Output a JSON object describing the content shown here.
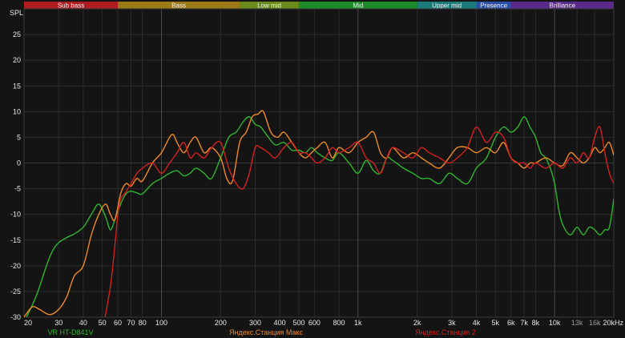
{
  "chart_data": {
    "type": "line",
    "ylabel": "SPL",
    "xscale": "log",
    "xlim": [
      20,
      20000
    ],
    "ylim": [
      -30,
      30
    ],
    "grid": true,
    "yticks": [
      25,
      20,
      15,
      10,
      5,
      0,
      -5,
      -10,
      -15,
      -20,
      -25,
      -30
    ],
    "xticks": [
      {
        "v": 20,
        "label": "20"
      },
      {
        "v": 30,
        "label": "30"
      },
      {
        "v": 40,
        "label": "40"
      },
      {
        "v": 50,
        "label": "50"
      },
      {
        "v": 60,
        "label": "60"
      },
      {
        "v": 70,
        "label": "70"
      },
      {
        "v": 80,
        "label": "80"
      },
      {
        "v": 100,
        "label": "100"
      },
      {
        "v": 200,
        "label": "200"
      },
      {
        "v": 300,
        "label": "300"
      },
      {
        "v": 400,
        "label": "400"
      },
      {
        "v": 500,
        "label": "500"
      },
      {
        "v": 600,
        "label": "600"
      },
      {
        "v": 800,
        "label": "800"
      },
      {
        "v": 1000,
        "label": "1k"
      },
      {
        "v": 2000,
        "label": "2k"
      },
      {
        "v": 3000,
        "label": "3k"
      },
      {
        "v": 4000,
        "label": "4k"
      },
      {
        "v": 5000,
        "label": "5k"
      },
      {
        "v": 6000,
        "label": "6k"
      },
      {
        "v": 7000,
        "label": "7k"
      },
      {
        "v": 8000,
        "label": "8k"
      },
      {
        "v": 10000,
        "label": "10k"
      },
      {
        "v": 13000,
        "label": "13k"
      },
      {
        "v": 16000,
        "label": "16k"
      },
      {
        "v": 20000,
        "label": "20kHz"
      }
    ],
    "bands": [
      {
        "name": "Sub bass",
        "from": 20,
        "to": 60,
        "color": "#b01c22"
      },
      {
        "name": "Bass",
        "from": 60,
        "to": 250,
        "color": "#9c7a17"
      },
      {
        "name": "Low mid",
        "from": 250,
        "to": 500,
        "color": "#6a8a1a"
      },
      {
        "name": "Mid",
        "from": 500,
        "to": 2000,
        "color": "#1f8a2a"
      },
      {
        "name": "Upper mid",
        "from": 2000,
        "to": 4000,
        "color": "#1b7a7a"
      },
      {
        "name": "Presence",
        "from": 4000,
        "to": 6000,
        "color": "#2a4ea8"
      },
      {
        "name": "Brilliance",
        "from": 6000,
        "to": 20000,
        "color": "#5a2a8a"
      }
    ],
    "series": [
      {
        "name": "VR HT-D841V",
        "color": "#2fb52f",
        "x": [
          20,
          23,
          26,
          28,
          30,
          33,
          36,
          40,
          44,
          48,
          52,
          55,
          58,
          62,
          66,
          70,
          75,
          80,
          90,
          100,
          110,
          120,
          130,
          140,
          150,
          165,
          180,
          200,
          220,
          240,
          260,
          280,
          300,
          320,
          350,
          380,
          420,
          460,
          500,
          540,
          580,
          620,
          680,
          740,
          800,
          900,
          1000,
          1100,
          1200,
          1300,
          1400,
          1500,
          1700,
          1900,
          2100,
          2300,
          2600,
          2900,
          3200,
          3600,
          4000,
          4500,
          5000,
          5500,
          6000,
          6500,
          7000,
          7500,
          8000,
          8500,
          9000,
          9500,
          10000,
          10500,
          11000,
          12000,
          13000,
          14000,
          15000,
          16000,
          17000,
          18000,
          19000,
          20000
        ],
        "y": [
          -31,
          -26,
          -20,
          -17,
          -15.5,
          -14.5,
          -13.8,
          -12.5,
          -10,
          -8,
          -10.5,
          -13,
          -11,
          -8,
          -6,
          -5.5,
          -5.8,
          -6,
          -4,
          -3,
          -2,
          -1.5,
          -2.5,
          -2,
          -1,
          -2,
          -3,
          1,
          5,
          6,
          8,
          9,
          7.5,
          7,
          5,
          3.5,
          4,
          2.5,
          2.5,
          2,
          3,
          2,
          1,
          0.5,
          2,
          0,
          -2,
          0.5,
          -1.5,
          -2,
          1,
          0.5,
          -1,
          -2,
          -3,
          -3,
          -4,
          -2,
          -3,
          -4,
          -1,
          1,
          5,
          7,
          6,
          7,
          9,
          7,
          5,
          2,
          1,
          -1,
          -4,
          -9,
          -12,
          -14,
          -12.5,
          -14,
          -12.5,
          -13,
          -14,
          -13,
          -12.5,
          -7
        ]
      },
      {
        "name": "Яндекс.Станция Макс",
        "color": "#f08a28",
        "x": [
          20,
          22,
          24,
          27,
          30,
          33,
          36,
          40,
          44,
          48,
          52,
          55,
          58,
          62,
          66,
          70,
          75,
          80,
          90,
          100,
          110,
          115,
          120,
          130,
          140,
          150,
          165,
          180,
          200,
          215,
          230,
          250,
          270,
          290,
          310,
          330,
          360,
          390,
          420,
          460,
          500,
          540,
          580,
          620,
          680,
          740,
          800,
          900,
          1000,
          1100,
          1200,
          1300,
          1400,
          1500,
          1700,
          1900,
          2100,
          2300,
          2600,
          2900,
          3200,
          3600,
          4000,
          4500,
          5000,
          5500,
          6000,
          6500,
          7000,
          7500,
          8000,
          9000,
          10000,
          11000,
          12000,
          13000,
          14000,
          15000,
          16000,
          17000,
          18000,
          19000,
          20000
        ],
        "y": [
          -30,
          -28,
          -28.5,
          -29.5,
          -28.5,
          -26,
          -22,
          -20,
          -14,
          -10,
          -8,
          -10,
          -11,
          -6,
          -4,
          -4.5,
          -3,
          -3.5,
          0,
          2,
          5,
          5.5,
          4,
          2,
          4,
          5,
          2,
          3,
          1,
          -3,
          -3.5,
          4,
          6,
          9,
          9.5,
          10,
          6,
          5,
          6,
          4,
          2,
          1,
          2,
          3,
          4,
          1,
          3,
          2,
          4,
          5,
          6,
          2,
          1,
          3,
          1,
          2,
          1,
          0,
          -1,
          1,
          3,
          3,
          2,
          3,
          2,
          4,
          1,
          0,
          -1,
          0,
          0,
          1,
          0,
          -0.5,
          2,
          1,
          0,
          1,
          3,
          2,
          3,
          4,
          1.5
        ]
      },
      {
        "name": "Яндекс.Станция 2",
        "color": "#d42020",
        "x": [
          50,
          55,
          58,
          60,
          62,
          65,
          70,
          75,
          80,
          90,
          100,
          110,
          120,
          130,
          140,
          150,
          165,
          180,
          200,
          220,
          240,
          260,
          280,
          300,
          320,
          350,
          380,
          420,
          460,
          500,
          540,
          580,
          620,
          680,
          740,
          800,
          900,
          1000,
          1100,
          1200,
          1300,
          1400,
          1500,
          1700,
          1900,
          2100,
          2300,
          2600,
          2900,
          3200,
          3600,
          4000,
          4500,
          5000,
          5500,
          6000,
          6500,
          7000,
          7500,
          8000,
          9000,
          10000,
          11000,
          12000,
          13000,
          14000,
          15000,
          16000,
          17000,
          18000,
          19000,
          20000
        ],
        "y": [
          -33,
          -24,
          -16,
          -10,
          -7,
          -6,
          -4,
          -2,
          -1,
          0,
          -2,
          0,
          2,
          4,
          1,
          2,
          1,
          3,
          4,
          -1,
          -4,
          -5,
          -2,
          3,
          3,
          2,
          1,
          3,
          4,
          2,
          2,
          1,
          0,
          1,
          3,
          2,
          3,
          4,
          1,
          0,
          -2,
          1,
          3,
          2,
          1,
          3,
          2,
          1,
          0,
          1,
          3,
          7,
          4,
          6,
          5,
          1,
          0,
          0,
          -1,
          0,
          -1,
          0,
          -1,
          1,
          0,
          2,
          1,
          5,
          7,
          2,
          -2,
          -4
        ]
      }
    ]
  }
}
